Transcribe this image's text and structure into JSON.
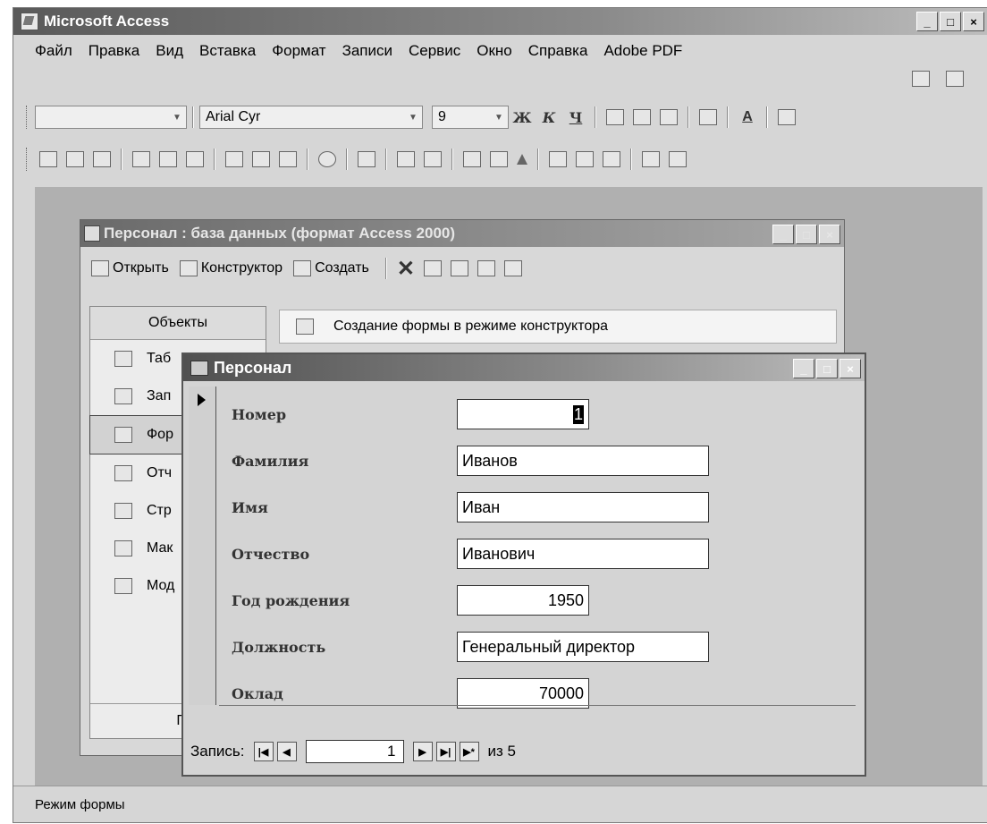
{
  "app": {
    "title": "Microsoft Access",
    "window_buttons": [
      "_",
      "□",
      "×"
    ]
  },
  "menu": {
    "items": [
      "Файл",
      "Правка",
      "Вид",
      "Вставка",
      "Формат",
      "Записи",
      "Сервис",
      "Окно",
      "Справка",
      "Adobe PDF"
    ]
  },
  "format_toolbar": {
    "object_combo": "",
    "font_name": "Arial Cyr",
    "font_size": "9",
    "bold": "Ж",
    "italic": "К",
    "underline": "Ч",
    "font_color_label": "A"
  },
  "db_window": {
    "title": "Персонал : база данных (формат Access 2000)",
    "toolbar": {
      "open": "Открыть",
      "design": "Конструктор",
      "create": "Создать"
    },
    "objects_header": "Объекты",
    "objects": [
      "Таб",
      "Зап",
      "Фор",
      "Отч",
      "Стр",
      "Мак",
      "Мод"
    ],
    "groups_label": "Груп",
    "list_item": "Создание формы в режиме конструктора"
  },
  "form": {
    "title": "Персонал",
    "fields": [
      {
        "label": "Номер",
        "value": "1"
      },
      {
        "label": "Фамилия",
        "value": "Иванов"
      },
      {
        "label": "Имя",
        "value": "Иван"
      },
      {
        "label": "Отчество",
        "value": "Иванович"
      },
      {
        "label": "Год рождения",
        "value": "1950"
      },
      {
        "label": "Должность",
        "value": "Генеральный директор"
      },
      {
        "label": "Оклад",
        "value": "70000"
      }
    ],
    "nav": {
      "label": "Запись:",
      "current": "1",
      "of_label": "из 5"
    }
  },
  "status": {
    "text": "Режим формы"
  }
}
